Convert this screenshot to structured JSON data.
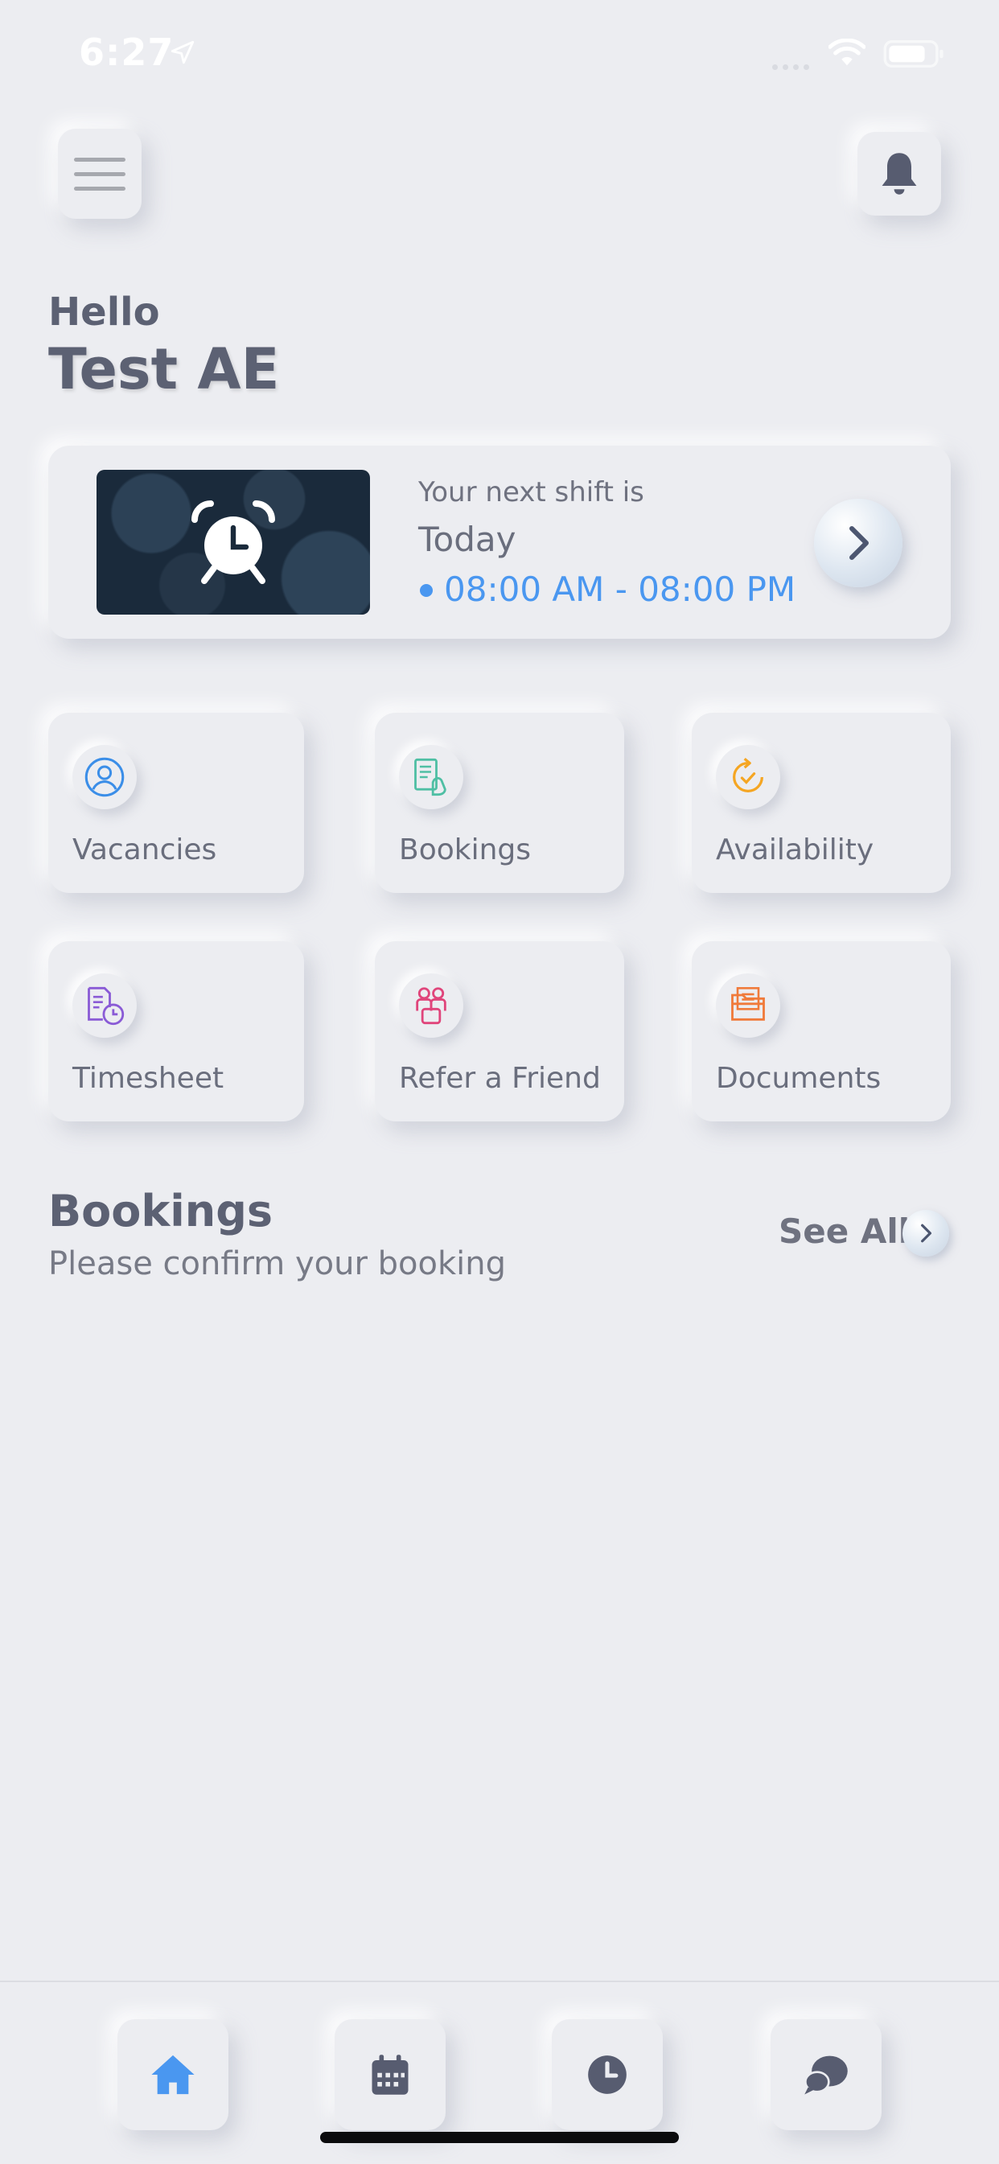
{
  "status_bar": {
    "time": "6:27",
    "icons": [
      "location-arrow-icon",
      "signal-icon",
      "wifi-icon",
      "battery-icon"
    ]
  },
  "header": {
    "menu_icon": "hamburger-menu-icon",
    "notification_icon": "bell-icon"
  },
  "greeting": {
    "hello": "Hello",
    "name": "Test AE"
  },
  "shift": {
    "label": "Your next shift is",
    "day": "Today",
    "time_range": "08:00 AM - 08:00 PM",
    "image_icon": "alarm-clock-icon",
    "action_icon": "chevron-right-icon"
  },
  "tiles": [
    {
      "label": "Vacancies",
      "icon": "user-circle-icon",
      "color": "#3b8ee8"
    },
    {
      "label": "Bookings",
      "icon": "clipboard-hand-icon",
      "color": "#4fbfa4"
    },
    {
      "label": "Availability",
      "icon": "refresh-clock-icon",
      "color": "#f5a623"
    },
    {
      "label": "Timesheet",
      "icon": "document-clock-icon",
      "color": "#8a5bd6"
    },
    {
      "label": "Refer a Friend",
      "icon": "people-icon",
      "color": "#e0457b"
    },
    {
      "label": "Documents",
      "icon": "folder-documents-icon",
      "color": "#f07a3a"
    }
  ],
  "bookings": {
    "title": "Bookings",
    "subtitle": "Please confirm your booking",
    "see_all": "See All"
  },
  "bottom_nav": [
    {
      "icon": "home-icon",
      "active": true
    },
    {
      "icon": "calendar-icon",
      "active": false
    },
    {
      "icon": "clock-icon",
      "active": false
    },
    {
      "icon": "chat-bubbles-icon",
      "active": false
    }
  ],
  "colors": {
    "background": "#ecedf1",
    "accent": "#4a97f0",
    "text": "#5c6173"
  }
}
